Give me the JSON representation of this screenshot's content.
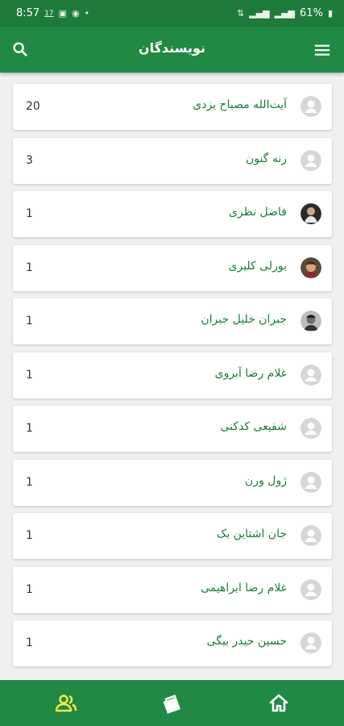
{
  "status": {
    "time": "8:57",
    "date_badge": "17",
    "battery": "61%"
  },
  "appbar": {
    "title": "نویسندگان"
  },
  "authors": [
    {
      "name": "آیت‌الله مصباح یزدی",
      "count": "20",
      "avatar": "default"
    },
    {
      "name": "رنه گنون",
      "count": "3",
      "avatar": "default"
    },
    {
      "name": "فاضل نظری",
      "count": "1",
      "avatar": "photo-dark"
    },
    {
      "name": "بورلی کلیری",
      "count": "1",
      "avatar": "photo-color"
    },
    {
      "name": "جبران خلیل جبران",
      "count": "1",
      "avatar": "photo-bw"
    },
    {
      "name": "غلام رضا آبروی",
      "count": "1",
      "avatar": "default"
    },
    {
      "name": "شفیعی کدکنی",
      "count": "1",
      "avatar": "default"
    },
    {
      "name": "ژول ورن",
      "count": "1",
      "avatar": "default"
    },
    {
      "name": "جان اشتاین بک",
      "count": "1",
      "avatar": "default"
    },
    {
      "name": "غلام رضا ابراهیمی",
      "count": "1",
      "avatar": "default"
    },
    {
      "name": "حسین حیدر بیگی",
      "count": "1",
      "avatar": "default"
    }
  ],
  "colors": {
    "primary": "#208a45",
    "status_bar": "#1e7b3c",
    "accent": "#ffeb3b",
    "name_text": "#1e7b3c"
  },
  "bottom_nav": [
    {
      "icon": "people-icon",
      "active": true
    },
    {
      "icon": "books-icon",
      "active": false
    },
    {
      "icon": "home-icon",
      "active": false
    }
  ]
}
